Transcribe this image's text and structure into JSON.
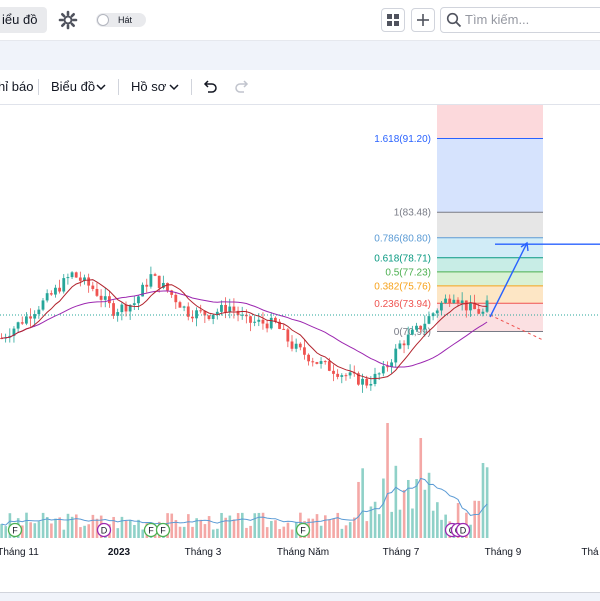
{
  "header": {
    "chart_button": "iểu đồ",
    "toggle_label": "Hát",
    "search_placeholder": "Tìm kiếm..."
  },
  "toolbar": {
    "alerts": "hỉ báo",
    "chart": "Biểu đồ",
    "profile": "Hồ sơ"
  },
  "colors": {
    "up": "#26a69a",
    "down": "#ef5350",
    "ma_fast": "#b2242e",
    "ma_slow": "#9c27b0",
    "volume_ma": "#5b9bd5",
    "target_arrow": "#2962ff"
  },
  "chart_data": {
    "type": "candlestick",
    "x_ticks": [
      "Tháng 11",
      "2023",
      "Tháng 3",
      "Tháng Năm",
      "Tháng 7",
      "Tháng 9",
      "Thá"
    ],
    "fibonacci": [
      {
        "label": "1.618(91.20)",
        "ratio": 1.618,
        "price": 91.2,
        "color": "#2962ff"
      },
      {
        "label": "1(83.48)",
        "ratio": 1,
        "price": 83.48,
        "color": "#787b86"
      },
      {
        "label": "0.786(80.80)",
        "ratio": 0.786,
        "price": 80.8,
        "color": "#5b9bd5"
      },
      {
        "label": "0.618(78.71)",
        "ratio": 0.618,
        "price": 78.71,
        "color": "#089981"
      },
      {
        "label": "0.5(77.23)",
        "ratio": 0.5,
        "price": 77.23,
        "color": "#4caf50"
      },
      {
        "label": "0.382(75.76)",
        "ratio": 0.382,
        "price": 75.76,
        "color": "#f7a21b"
      },
      {
        "label": "0.236(73.94)",
        "ratio": 0.236,
        "price": 73.94,
        "color": "#ef5350"
      },
      {
        "label": "0(70,99)",
        "ratio": 0,
        "price": 70.99,
        "color": "#787b86"
      }
    ],
    "event_markers": [
      {
        "letter": "F",
        "color": "#4caf50"
      },
      {
        "letter": "D",
        "color": "#9c27b0"
      },
      {
        "letter": "F",
        "color": "#4caf50"
      },
      {
        "letter": "F",
        "color": "#4caf50"
      },
      {
        "letter": "F",
        "color": "#4caf50"
      },
      {
        "letter": "C",
        "color": "#9c27b0"
      },
      {
        "letter": "C",
        "color": "#9c27b0"
      },
      {
        "letter": "D",
        "color": "#9c27b0"
      }
    ]
  }
}
